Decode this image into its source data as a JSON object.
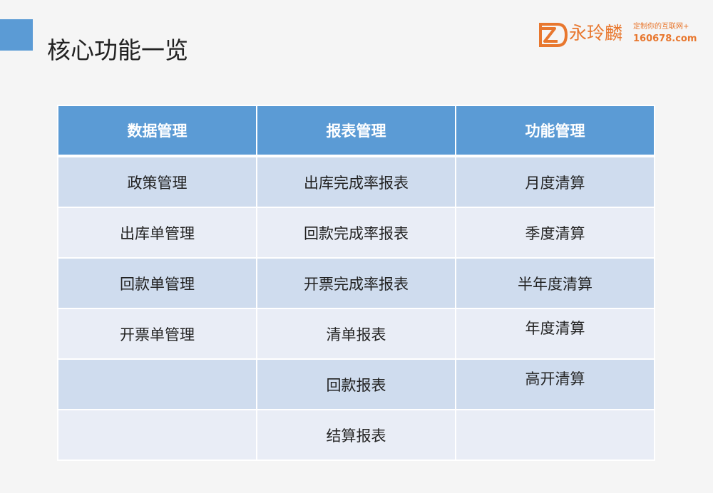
{
  "slide": {
    "title": "核心功能一览"
  },
  "logo": {
    "name": "永玲麟",
    "tagline": "定制你的互联网+",
    "url": "160678.com"
  },
  "colors": {
    "accent": "#5b9bd5",
    "row_odd": "#cfdcee",
    "row_even": "#e9edf6",
    "logo": "#e8772e"
  },
  "table": {
    "headers": [
      "数据管理",
      "报表管理",
      "功能管理"
    ],
    "rows": [
      [
        "政策管理",
        "出库完成率报表",
        "月度清算"
      ],
      [
        "出库单管理",
        "回款完成率报表",
        "季度清算"
      ],
      [
        "回款单管理",
        "开票完成率报表",
        "半年度清算"
      ],
      [
        "开票单管理",
        "清单报表",
        "年度清算"
      ],
      [
        "",
        "回款报表",
        "高开清算"
      ],
      [
        "",
        "结算报表",
        ""
      ]
    ]
  }
}
